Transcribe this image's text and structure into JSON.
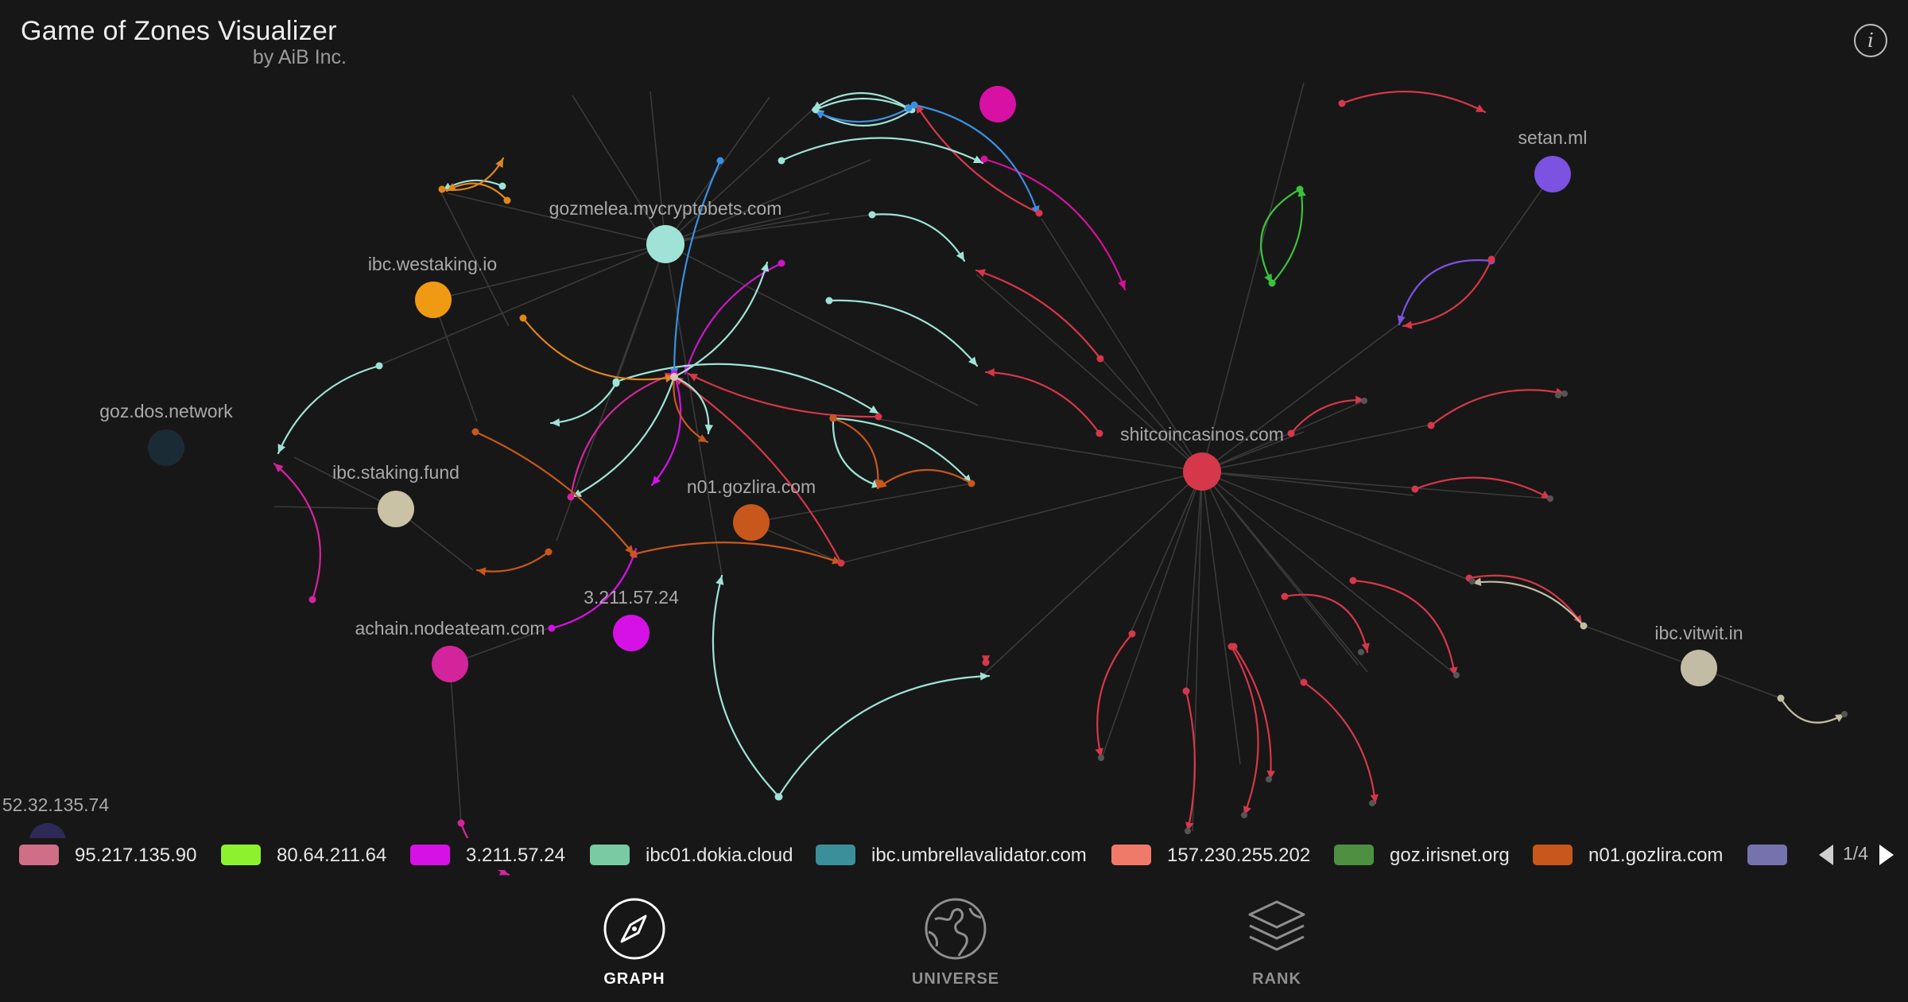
{
  "header": {
    "title": "Game of Zones Visualizer",
    "subtitle": "by AiB Inc.",
    "info_icon": "info-icon"
  },
  "graph": {
    "background": "#171717",
    "zones": [
      {
        "id": "shitcoin",
        "label": "shitcoincasinos.com",
        "color": "#d6374a"
      },
      {
        "id": "gozmelea",
        "label": "gozmelea.mycryptobets.com",
        "color": "#9fe3d6"
      },
      {
        "id": "westaking",
        "label": "ibc.westaking.io",
        "color": "#f09a14"
      },
      {
        "id": "dos",
        "label": "goz.dos.network",
        "color": "#1b2b36"
      },
      {
        "id": "stakingfund",
        "label": "ibc.staking.fund",
        "color": "#c9c2a5"
      },
      {
        "id": "gozlira",
        "label": "n01.gozlira.com",
        "color": "#c8571b"
      },
      {
        "id": "ip3211",
        "label": "3.211.57.24",
        "color": "#d611e6"
      },
      {
        "id": "achain",
        "label": "achain.nodeateam.com",
        "color": "#d4249c"
      },
      {
        "id": "setan",
        "label": "setan.ml",
        "color": "#7c52e0"
      },
      {
        "id": "vitwit",
        "label": "ibc.vitwit.in",
        "color": "#c2bca4"
      },
      {
        "id": "ip52",
        "label": "52.32.135.74",
        "color": "#2e2a57"
      },
      {
        "id": "topmagenta",
        "label": "",
        "color": "#d611a4"
      }
    ]
  },
  "legend": {
    "items": [
      {
        "label": "95.217.135.90",
        "color": "#d16e87"
      },
      {
        "label": "80.64.211.64",
        "color": "#8df22d"
      },
      {
        "label": "3.211.57.24",
        "color": "#d611e6"
      },
      {
        "label": "ibc01.dokia.cloud",
        "color": "#7acaa4"
      },
      {
        "label": "ibc.umbrellavalidator.com",
        "color": "#3b8f9b"
      },
      {
        "label": "157.230.255.202",
        "color": "#f07a6a"
      },
      {
        "label": "goz.irisnet.org",
        "color": "#4e8f42"
      },
      {
        "label": "n01.gozlira.com",
        "color": "#c8571b"
      },
      {
        "label": "",
        "color": "#7672ad"
      }
    ],
    "page": "1/4"
  },
  "nav": {
    "graph": "GRAPH",
    "universe": "UNIVERSE",
    "rank": "RANK",
    "graph_icon": "compass-icon",
    "universe_icon": "globe-icon",
    "rank_icon": "layers-icon"
  }
}
